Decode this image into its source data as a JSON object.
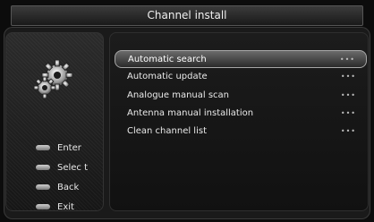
{
  "header": {
    "title": "Channel install"
  },
  "legend": [
    {
      "label": "Enter"
    },
    {
      "label": "Selec t"
    },
    {
      "label": "Back"
    },
    {
      "label": "Exit"
    }
  ],
  "menu": {
    "items": [
      {
        "label": "Automatic search",
        "more": "•••"
      },
      {
        "label": "Automatic update",
        "more": "•••"
      },
      {
        "label": "Analogue manual scan",
        "more": "•••"
      },
      {
        "label": "Antenna manual installation",
        "more": "•••"
      },
      {
        "label": "Clean channel list",
        "more": "•••"
      }
    ],
    "selected_index": 0
  },
  "icons": {
    "settings": "gear-icon"
  }
}
